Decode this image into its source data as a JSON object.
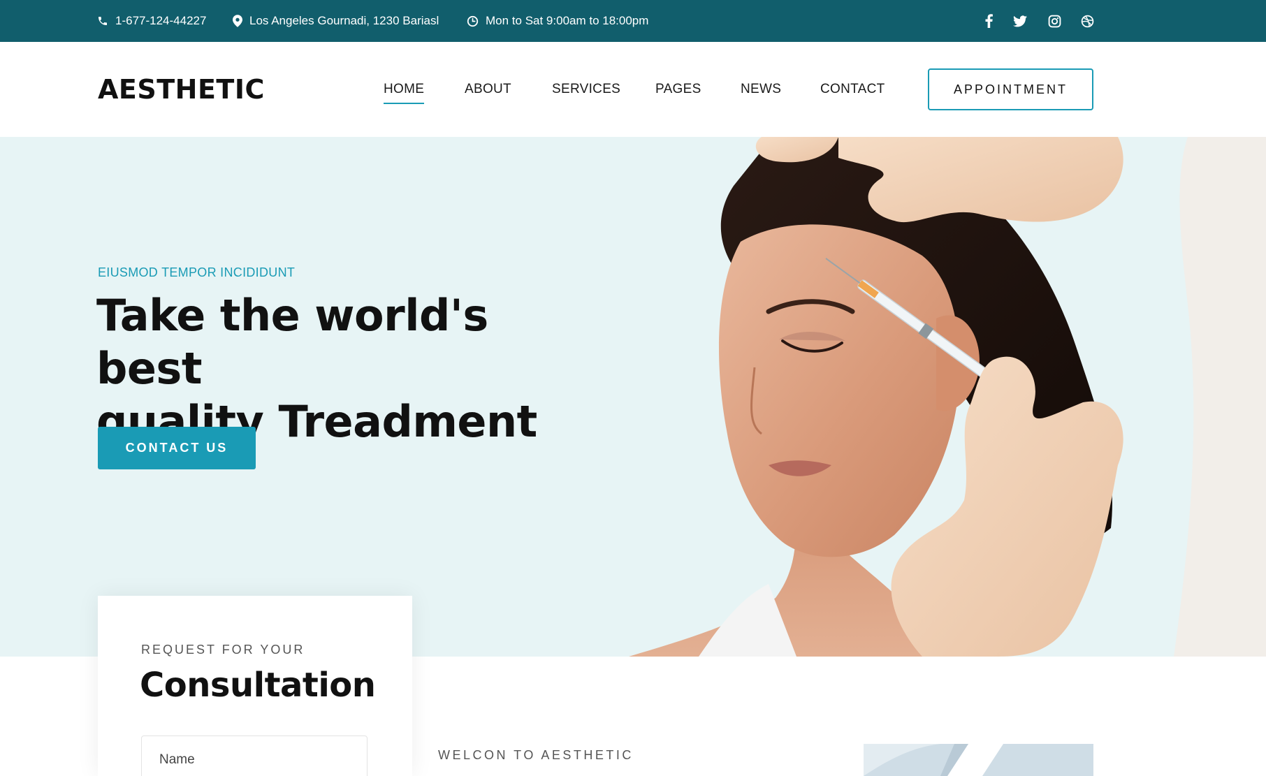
{
  "topbar": {
    "phone": "1-677-124-44227",
    "address": "Los Angeles Gournadi, 1230 Bariasl",
    "hours": "Mon to Sat 9:00am to 18:00pm",
    "social": [
      "facebook-icon",
      "twitter-icon",
      "instagram-icon",
      "dribbble-icon"
    ],
    "bg_color": "#115e6c"
  },
  "header": {
    "logo": "AESTHETIC",
    "nav": [
      "HOME",
      "ABOUT",
      "SERVICES",
      "PAGES",
      "NEWS",
      "CONTACT"
    ],
    "active_nav": "HOME",
    "appointment_label": "APPOINTMENT"
  },
  "hero": {
    "eyebrow": "EIUSMOD TEMPOR INCIDIDUNT",
    "title_line1": "Take the world's best",
    "title_line2": "quality Treadment",
    "cta_label": "CONTACT US",
    "accent_color": "#1a9bb5",
    "bg_color": "#e7f4f5"
  },
  "consultation": {
    "eyebrow": "REQUEST FOR YOUR",
    "title": "Consultation",
    "name_placeholder": "Name"
  },
  "welcome": {
    "eyebrow": "WELCON TO AESTHETIC"
  }
}
